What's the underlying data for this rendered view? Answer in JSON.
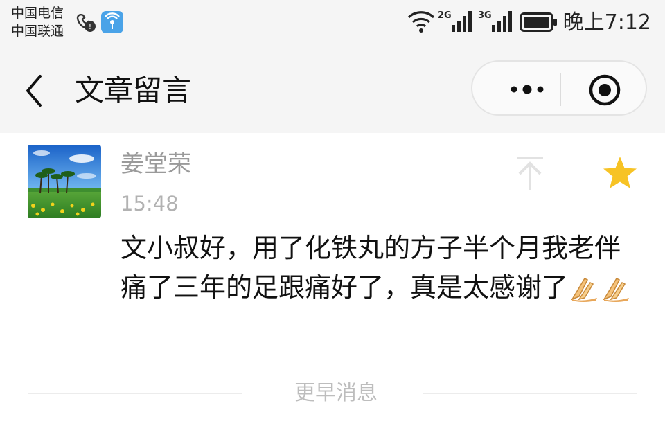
{
  "status_bar": {
    "carrier_1": "中国电信",
    "carrier_2": "中国联通",
    "network_1": "2G",
    "network_2": "3G",
    "time": "晚上7:12",
    "icons": [
      "hd-call-icon",
      "wifi-hotspot-app-icon",
      "wifi-icon",
      "signal-icon",
      "battery-icon"
    ]
  },
  "header": {
    "title": "文章留言",
    "back_icon": "chevron-left-icon",
    "more_icon": "more-dots-icon",
    "close_icon": "target-close-icon"
  },
  "comment": {
    "author": "姜堂荣",
    "time": "15:48",
    "text": "文小叔好，用了化铁丸的方子半个月我老伴痛了三年的足跟痛好了，真是太感谢了",
    "emoji": [
      "pray-hands-emoji",
      "pray-hands-emoji"
    ],
    "pin_icon": "pin-to-top-icon",
    "star_icon": "star-icon",
    "star_color": "#f7c325",
    "avatar": "landscape-avatar"
  },
  "footer": {
    "earlier_label": "更早消息"
  }
}
